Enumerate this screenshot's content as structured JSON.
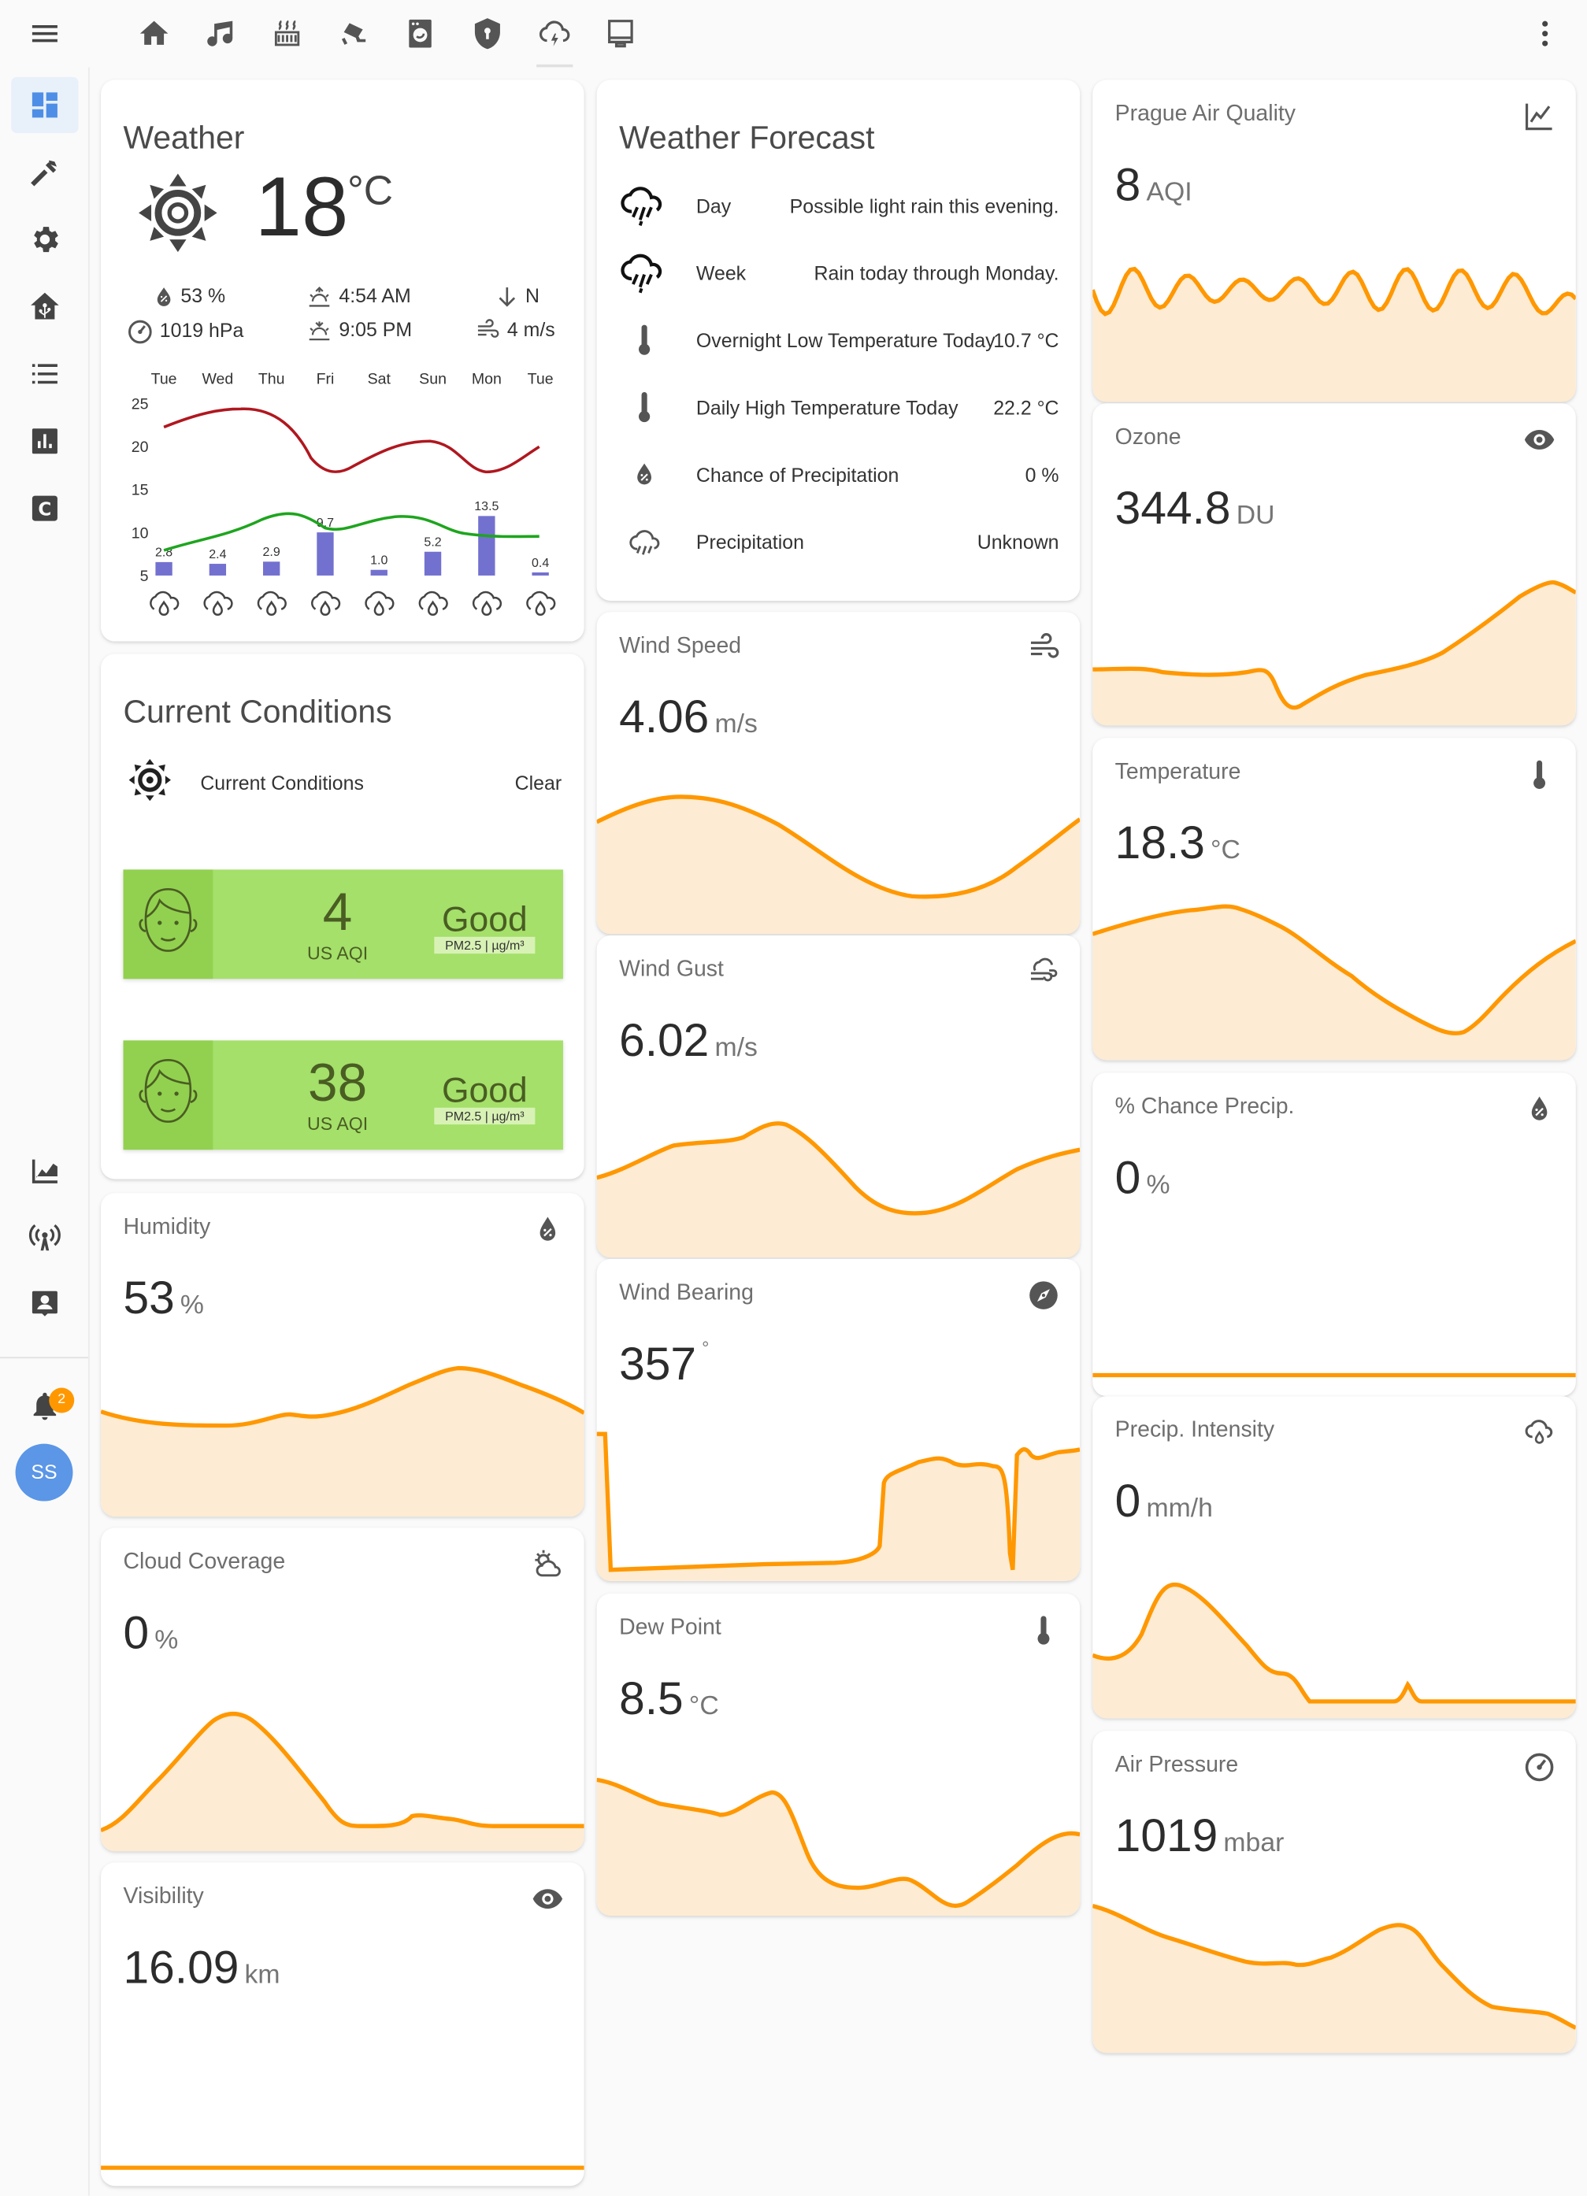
{
  "topbar": {
    "tabs": [
      "home-icon",
      "music-icon",
      "radiator-icon",
      "cctv-icon",
      "washing-machine-icon",
      "shield-icon",
      "weather-lightning-icon",
      "monitor-icon"
    ],
    "more": "more-vertical-icon"
  },
  "sidebar": {
    "items": [
      "dashboard-icon",
      "hammer-icon",
      "gear-icon",
      "home-assistant-icon",
      "list-icon",
      "chart-icon",
      "c-icon"
    ],
    "bottom_items": [
      "history-chart-icon",
      "radio-tower-icon",
      "account-box-icon"
    ],
    "notifications_count": "2",
    "user_initials": "SS"
  },
  "colors": {
    "accent": "#ff9800",
    "fill": "#fdebd3",
    "bars": "#7371cf",
    "hi_line": "#b0171f",
    "lo_line": "#1ea51e",
    "aqi_green": "#a4e06a"
  },
  "weather": {
    "title": "Weather",
    "temp": "18",
    "temp_unit": "°C",
    "humidity": "53 %",
    "pressure": "1019 hPa",
    "sunrise": "4:54 AM",
    "sunset": "9:05 PM",
    "wind_dir": "N",
    "wind_speed": "4 m/s",
    "days": [
      "Tue",
      "Wed",
      "Thu",
      "Fri",
      "Sat",
      "Sun",
      "Mon",
      "Tue"
    ],
    "y_ticks": [
      "25",
      "20",
      "15",
      "10",
      "5"
    ]
  },
  "chart_data": {
    "type": "bar",
    "categories": [
      "Tue",
      "Wed",
      "Thu",
      "Fri",
      "Sat",
      "Sun",
      "Mon",
      "Tue"
    ],
    "series": [
      {
        "values": [
          2.8,
          2.4,
          2.9,
          9.7,
          1.0,
          5.2,
          13.5,
          0.4
        ]
      }
    ],
    "data_labels": [
      "2.8",
      "2.4",
      "2.9",
      "9.7",
      "1.0",
      "5.2",
      "13.5",
      "0.4"
    ],
    "ylim": [
      5,
      25
    ],
    "grid": false
  },
  "forecast": {
    "title": "Weather Forecast",
    "rows": [
      {
        "label": "Day",
        "value": "Possible light rain this evening."
      },
      {
        "label": "Week",
        "value": "Rain today through Monday."
      },
      {
        "label": "Overnight Low Temperature Today",
        "value": "10.7 °C"
      },
      {
        "label": "Daily High Temperature Today",
        "value": "22.2 °C"
      },
      {
        "label": "Chance of Precipitation",
        "value": "0 %"
      },
      {
        "label": "Precipitation",
        "value": "Unknown"
      }
    ]
  },
  "conditions": {
    "title": "Current Conditions",
    "row_label": "Current Conditions",
    "row_value": "Clear",
    "aqi": [
      {
        "value": "4",
        "label": "US AQI",
        "status": "Good",
        "pollutant": "PM2.5 | µg/m³"
      },
      {
        "value": "38",
        "label": "US AQI",
        "status": "Good",
        "pollutant": "PM2.5 | µg/m³"
      }
    ]
  },
  "gauges": {
    "humidity": {
      "name": "Humidity",
      "value": "53",
      "unit": "%"
    },
    "cloud": {
      "name": "Cloud Coverage",
      "value": "0",
      "unit": "%"
    },
    "visibility": {
      "name": "Visibility",
      "value": "16.09",
      "unit": "km"
    },
    "wind_speed": {
      "name": "Wind Speed",
      "value": "4.06",
      "unit": "m/s"
    },
    "wind_gust": {
      "name": "Wind Gust",
      "value": "6.02",
      "unit": "m/s"
    },
    "wind_bearing": {
      "name": "Wind Bearing",
      "value": "357",
      "unit": "°"
    },
    "dew_point": {
      "name": "Dew Point",
      "value": "8.5",
      "unit": "°C"
    },
    "air_quality": {
      "name": "Prague Air Quality",
      "value": "8",
      "unit": "AQI"
    },
    "ozone": {
      "name": "Ozone",
      "value": "344.8",
      "unit": "DU"
    },
    "temperature": {
      "name": "Temperature",
      "value": "18.3",
      "unit": "°C"
    },
    "precip_chance": {
      "name": "% Chance Precip.",
      "value": "0",
      "unit": "%"
    },
    "precip_intensity": {
      "name": "Precip. Intensity",
      "value": "0",
      "unit": "mm/h"
    },
    "air_pressure": {
      "name": "Air Pressure",
      "value": "1019",
      "unit": "mbar"
    }
  }
}
